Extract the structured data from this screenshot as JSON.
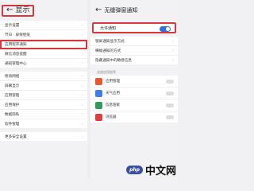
{
  "left": {
    "back_arrow": "←",
    "title": "显示",
    "items": [
      {
        "label": "显示设置"
      },
      {
        "label": "节日 · 屏保壁纸"
      },
      {
        "label": "应用程序通知",
        "highlight": true
      },
      {
        "label": "微信消息提醒"
      },
      {
        "label": "通知管理中心"
      },
      {
        "label": "移动网络"
      },
      {
        "label": "屏幕显示"
      },
      {
        "label": "应用管理"
      },
      {
        "label": "应用保护"
      },
      {
        "label": "数据隐私"
      },
      {
        "label": "软件管理"
      },
      {
        "label": "更多安全设置"
      }
    ]
  },
  "right": {
    "back_arrow": "←",
    "title": "无缝弹窗通知",
    "toggle": {
      "label": "允许通知",
      "state": "on"
    },
    "items": [
      {
        "label": "锁屏通知显示方式"
      },
      {
        "label": "横幅通知的方式"
      },
      {
        "label": "隐藏通知中的敏感信息"
      }
    ],
    "section_label": "全部应用程序",
    "apps": [
      {
        "name": "应用管理",
        "color": "#e9572f"
      },
      {
        "name": "天气应用",
        "color": "#3f7fe8"
      },
      {
        "name": "信息管家",
        "color": "#2f9d5a"
      },
      {
        "name": "浏览器",
        "color": "#e33a3a"
      }
    ]
  },
  "watermark": {
    "badge": "php",
    "text": "中文网"
  },
  "colors": {
    "highlight": "#d8383c",
    "switch_on": "#2f6fe0"
  }
}
